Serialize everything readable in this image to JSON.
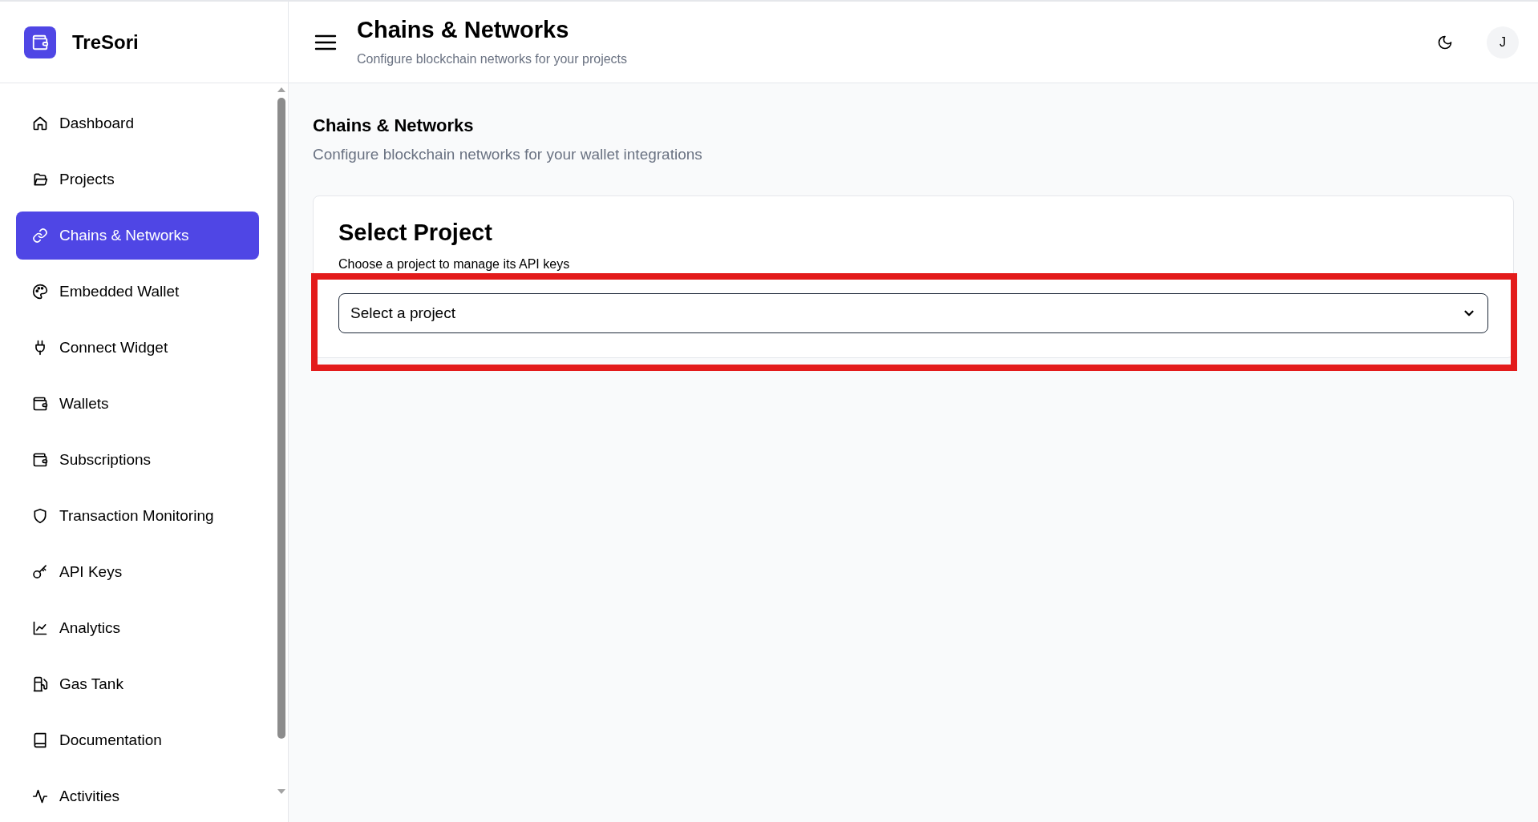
{
  "app": {
    "name": "TreSori"
  },
  "sidebar": {
    "items": [
      {
        "label": "Dashboard",
        "selected": false
      },
      {
        "label": "Projects",
        "selected": false
      },
      {
        "label": "Chains & Networks",
        "selected": true
      },
      {
        "label": "Embedded Wallet",
        "selected": false
      },
      {
        "label": "Connect Widget",
        "selected": false
      },
      {
        "label": "Wallets",
        "selected": false
      },
      {
        "label": "Subscriptions",
        "selected": false
      },
      {
        "label": "Transaction Monitoring",
        "selected": false
      },
      {
        "label": "API Keys",
        "selected": false
      },
      {
        "label": "Analytics",
        "selected": false
      },
      {
        "label": "Gas Tank",
        "selected": false
      },
      {
        "label": "Documentation",
        "selected": false
      },
      {
        "label": "Activities",
        "selected": false
      }
    ]
  },
  "header": {
    "title": "Chains & Networks",
    "subtitle": "Configure blockchain networks for your projects",
    "avatar": "J"
  },
  "page": {
    "title": "Chains & Networks",
    "subtitle": "Configure blockchain networks for your wallet integrations"
  },
  "card": {
    "title": "Select Project",
    "description": "Choose a project to manage its API keys",
    "select": {
      "value": "Select a project"
    }
  }
}
